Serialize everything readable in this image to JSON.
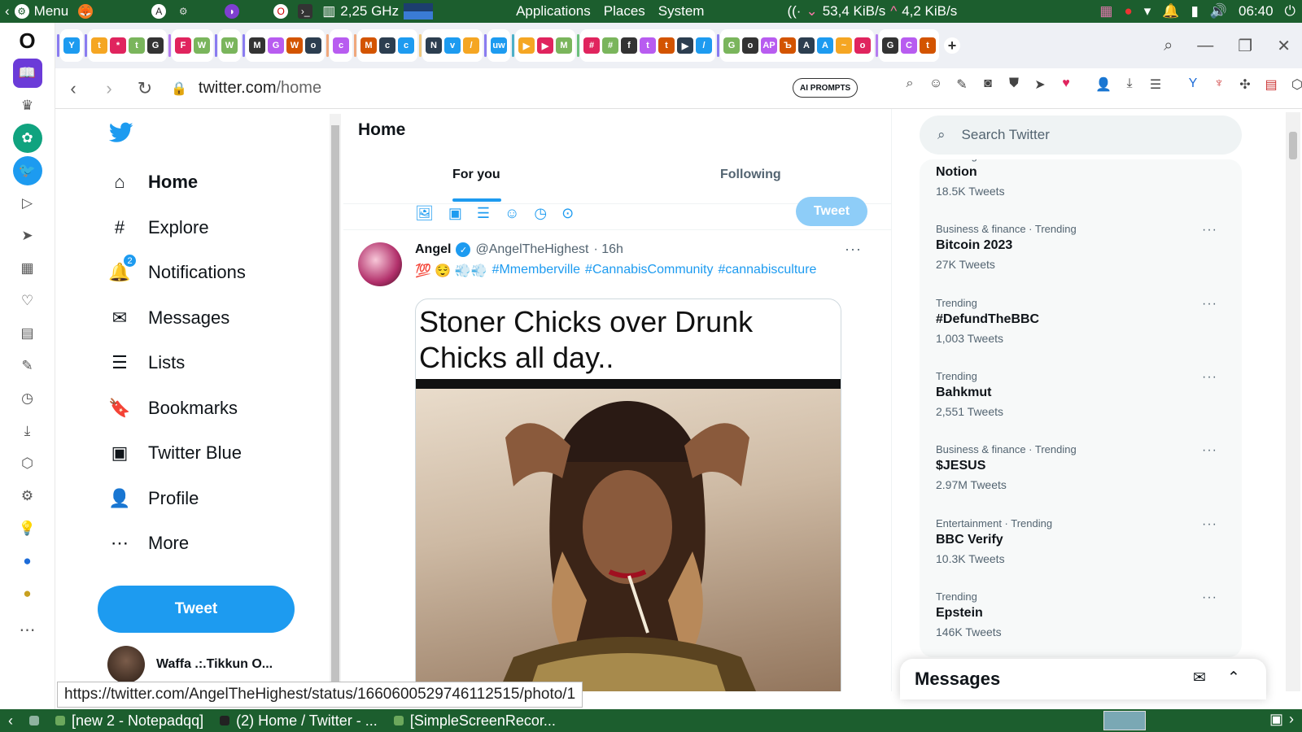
{
  "os_top": {
    "menu_label": "Menu",
    "cpu_freq": "2,25 GHz",
    "applications": "Applications",
    "places": "Places",
    "system": "System",
    "net_down": "53,4 KiB/s",
    "net_up": "4,2 KiB/s",
    "clock": "06:40"
  },
  "browser": {
    "url_host": "twitter.com",
    "url_path": "/home",
    "ai_prompts": "AI PROMPTS",
    "status_url": "https://twitter.com/AngelTheHighest/status/1660600529746112515/photo/1",
    "tab_groups": [
      {
        "color": "#8a7cf0",
        "icons": [
          "Y"
        ]
      },
      {
        "color": "#8a7cf0",
        "icons": [
          "t",
          "*",
          "t",
          "G"
        ]
      },
      {
        "color": "#b57cf0",
        "icons": [
          "F",
          "W"
        ]
      },
      {
        "color": "#8a7cf0",
        "icons": [
          "W"
        ]
      },
      {
        "color": "#8a7cf0",
        "icons": [
          "M",
          "G",
          "W",
          "o"
        ]
      },
      {
        "color": "#f0a87c",
        "icons": [
          "c"
        ]
      },
      {
        "color": "#f0a87c",
        "icons": [
          "M",
          "c",
          "c"
        ]
      },
      {
        "color": "#f0c87c",
        "icons": [
          "N",
          "v",
          "/"
        ]
      },
      {
        "color": "#8a7cf0",
        "icons": [
          "uw"
        ]
      },
      {
        "color": "#4cb0c8",
        "icons": [
          "▶",
          "▶",
          "M"
        ]
      },
      {
        "color": "#6cc07c",
        "icons": [
          "#",
          "#",
          "f",
          "t",
          "t",
          "▶",
          "/"
        ]
      },
      {
        "color": "#8a7cf0",
        "icons": [
          "G",
          "o",
          "AP",
          "Ъ",
          "A",
          "A",
          "~",
          "o"
        ]
      },
      {
        "color": "#b57cf0",
        "icons": [
          "G",
          "C",
          "t"
        ]
      }
    ]
  },
  "sidebar_nav": [
    {
      "label": "Home",
      "name": "nav-home",
      "icon": "home-icon",
      "glyph": "⌂",
      "active": true
    },
    {
      "label": "Explore",
      "name": "nav-explore",
      "icon": "hashtag-icon",
      "glyph": "#"
    },
    {
      "label": "Notifications",
      "name": "nav-notifications",
      "icon": "bell-icon",
      "glyph": "🔔",
      "badge": "2"
    },
    {
      "label": "Messages",
      "name": "nav-messages",
      "icon": "envelope-icon",
      "glyph": "✉"
    },
    {
      "label": "Lists",
      "name": "nav-lists",
      "icon": "list-icon",
      "glyph": "☰"
    },
    {
      "label": "Bookmarks",
      "name": "nav-bookmarks",
      "icon": "bookmark-icon",
      "glyph": "🔖"
    },
    {
      "label": "Twitter Blue",
      "name": "nav-twitter-blue",
      "icon": "twitter-blue-icon",
      "glyph": "▣"
    },
    {
      "label": "Profile",
      "name": "nav-profile",
      "icon": "person-icon",
      "glyph": "👤"
    },
    {
      "label": "More",
      "name": "nav-more",
      "icon": "more-circle-icon",
      "glyph": "⋯"
    }
  ],
  "tweet_button": "Tweet",
  "account": {
    "name": "Waffa .:.Tikkun O...",
    "dots": "..."
  },
  "feed": {
    "title": "Home",
    "tab_foryou": "For you",
    "tab_following": "Following",
    "compose_tweet_label": "Tweet"
  },
  "tweet": {
    "name": "Angel",
    "handle": "@AngelTheHighest",
    "time": "· 16h",
    "emoji": "💯 😌 💨💨",
    "hashtags": [
      "#Mmemberville",
      "#CannabisCommunity",
      "#cannabisculture"
    ],
    "image_caption": "Stoner Chicks over Drunk Chicks all day.."
  },
  "search": {
    "placeholder": "Search Twitter"
  },
  "trends": [
    {
      "context": "Trending",
      "name": "Notion",
      "count": "18.5K Tweets"
    },
    {
      "context": "Business & finance · Trending",
      "name": "Bitcoin 2023",
      "count": "27K Tweets"
    },
    {
      "context": "Trending",
      "name": "#DefundTheBBC",
      "count": "1,003 Tweets"
    },
    {
      "context": "Trending",
      "name": "Bahkmut",
      "count": "2,551 Tweets"
    },
    {
      "context": "Business & finance · Trending",
      "name": "$JESUS",
      "count": "2.97M Tweets"
    },
    {
      "context": "Entertainment · Trending",
      "name": "BBC Verify",
      "count": "10.3K Tweets"
    },
    {
      "context": "Trending",
      "name": "Epstein",
      "count": "146K Tweets"
    }
  ],
  "messages_dock": {
    "title": "Messages"
  },
  "taskbar": {
    "items": [
      {
        "label": "[new 2 - Notepadqq]",
        "color": "#6ca85c"
      },
      {
        "label": "(2) Home / Twitter - ...",
        "color": "#222"
      },
      {
        "label": "[SimpleScreenRecor...",
        "color": "#6ca85c"
      }
    ]
  },
  "colors": {
    "twitter_blue": "#1d9bf0",
    "os_panel": "#1c5e2e"
  }
}
